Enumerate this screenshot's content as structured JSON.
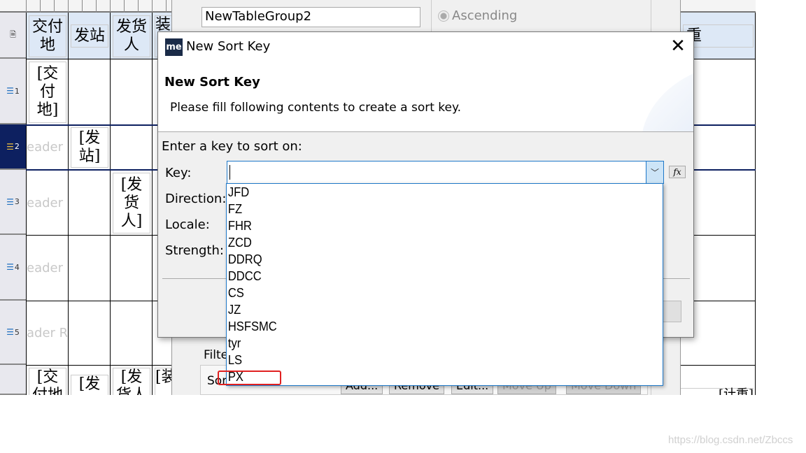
{
  "table": {
    "headers": [
      "交付地",
      "发站",
      "发货人",
      "装"
    ],
    "row_numbers": [
      "1",
      "2",
      "3",
      "4",
      "5"
    ],
    "cells": {
      "r1": "[交付地]",
      "r2": "[发站]",
      "r3": "[发货人]",
      "r6a": "[交付地",
      "r6b": "[发",
      "r6c": "[发货人",
      "r6d": "[装"
    },
    "ghost_text": [
      "eader R",
      "eader R",
      "eader R",
      "ader Ro"
    ],
    "right_header": "重",
    "right_bottom": "[计重]"
  },
  "background_dialog": {
    "group_name": "NewTableGroup2",
    "radio_ascending": "Ascending",
    "filter_label": "Filte",
    "sort_label": "Sor",
    "buttons": [
      {
        "label": "Add...",
        "disabled": false
      },
      {
        "label": "Remove",
        "disabled": false
      },
      {
        "label": "Edit...",
        "disabled": false
      },
      {
        "label": "Move Up",
        "disabled": true
      },
      {
        "label": "Move Down",
        "disabled": true
      }
    ]
  },
  "dialog": {
    "app_icon": "me",
    "title": "New Sort Key",
    "heading": "New Sort Key",
    "description": "Please fill following contents to create a sort key.",
    "section_label": "Enter a key to sort on:",
    "fields": {
      "key": "Key:",
      "direction": "Direction:",
      "locale": "Locale:",
      "strength": "Strength:"
    },
    "key_value": "",
    "fx_label": "fx",
    "options": [
      "JFD",
      "FZ",
      "FHR",
      "ZCD",
      "DDRQ",
      "DDCC",
      "CS",
      "JZ",
      "HSFSMC",
      "tyr",
      "LS",
      "PX"
    ],
    "highlighted_option": "PX"
  },
  "watermark": "https://blog.csdn.net/Zbccs",
  "colors": {
    "accent": "#1e78c8",
    "selected_row": "#0d2060",
    "highlight": "#e02020"
  }
}
